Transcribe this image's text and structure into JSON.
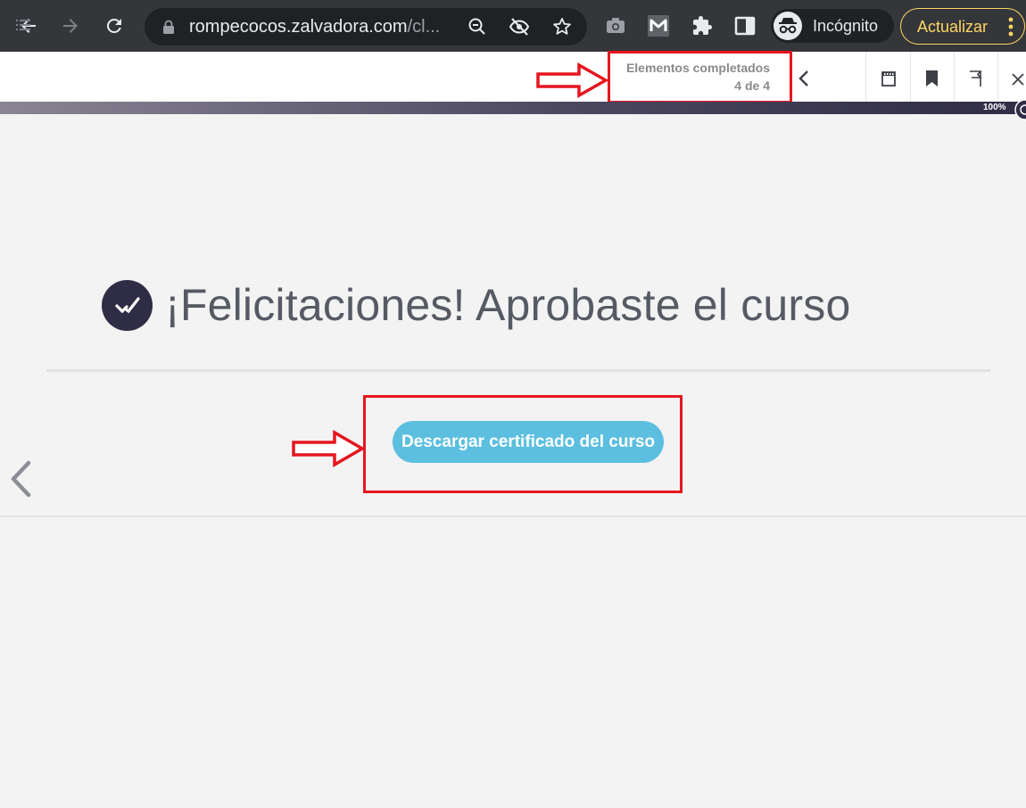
{
  "browser": {
    "url_main": "rompecocos.zalvadora.com",
    "url_rest": "/cl...",
    "incognito_label": "Incógnito",
    "update_label": "Actualizar"
  },
  "progress": {
    "title": "Elementos completados",
    "count": "4 de 4"
  },
  "zoom": "100%",
  "main": {
    "headline": "¡Felicitaciones! Aprobaste el curso",
    "certificate_button": "Descargar certificado del curso"
  },
  "icons": {
    "back": "arrow-left-icon",
    "forward": "arrow-right-icon",
    "reload": "reload-icon",
    "lock": "lock-icon",
    "zoom_out": "zoom-out-icon",
    "eye_off": "eye-off-icon",
    "star": "star-icon",
    "camera": "camera-icon",
    "m_ext": "m-extension-icon",
    "puzzle": "puzzle-icon",
    "sidepanel": "side-panel-icon",
    "menu": "list-icon",
    "chevron_left": "chevron-left-icon",
    "notes": "notes-icon",
    "bookmark": "bookmark-icon",
    "flag": "flag-icon",
    "close": "close-icon",
    "check": "check-icon"
  },
  "colors": {
    "chrome_bg": "#35363a",
    "accent_dark": "#2f2c45",
    "button": "#5cbfdf",
    "annotation_red": "#e5161f",
    "update_yellow": "#fdd663"
  }
}
